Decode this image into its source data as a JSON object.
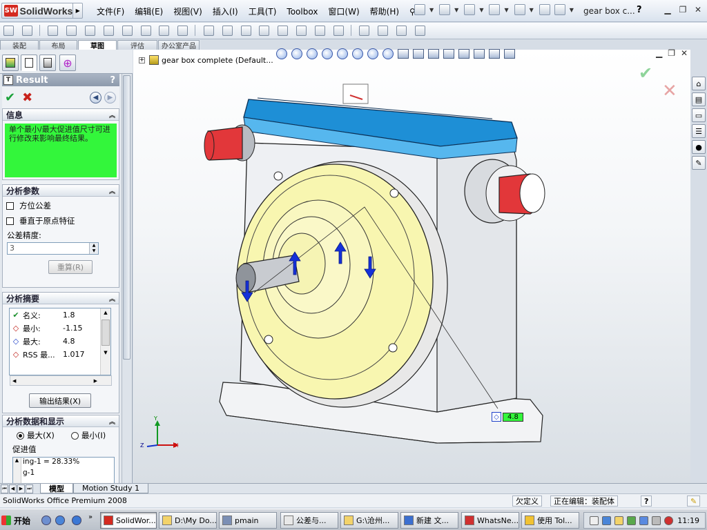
{
  "app": {
    "logo_text": "SolidWorks",
    "doc_title": "gear box c...",
    "help": "?"
  },
  "menu": {
    "items": [
      "文件(F)",
      "编辑(E)",
      "视图(V)",
      "插入(I)",
      "工具(T)",
      "Toolbox",
      "窗口(W)",
      "帮助(H)"
    ]
  },
  "command_tabs": [
    "装配",
    "布局",
    "草图",
    "评估",
    "办公室产品"
  ],
  "property_manager": {
    "title": "Result",
    "help": "?",
    "info": {
      "header": "信息",
      "message": "单个最小/最大促进值尺寸可进行修改来影响最终结果。"
    },
    "params": {
      "header": "分析参数",
      "checkbox_1": "方位公差",
      "checkbox_2": "垂直于原点特征",
      "precision_label": "公差精度:",
      "precision_value": "3",
      "recalc_button": "重算(R)"
    },
    "summary": {
      "header": "分析摘要",
      "rows": [
        {
          "label": "名义:",
          "value": "1.8"
        },
        {
          "label": "最小:",
          "value": "-1.15"
        },
        {
          "label": "最大:",
          "value": "4.8"
        },
        {
          "label": "RSS 最...",
          "value": "1.017"
        }
      ],
      "export_button": "输出结果(X)"
    },
    "display": {
      "header": "分析数据和显示",
      "radio_max": "最大(X)",
      "radio_min": "最小(I)",
      "contrib_label": "促进值",
      "contrib_items": [
        "ing-1 = 28.33%",
        "g-1"
      ]
    }
  },
  "graphics": {
    "tree_node": "gear box complete  (Default...",
    "dimension_tag": "4.8",
    "triad": {
      "x": "X",
      "y": "Y",
      "z": "Z"
    }
  },
  "bottom_tabs": [
    "模型",
    "Motion Study 1"
  ],
  "status": {
    "app_name": "SolidWorks Office Premium 2008",
    "under_defined": "欠定义",
    "editing": "正在编辑：装配体",
    "help": "?"
  },
  "taskbar": {
    "start": "开始",
    "tasks": [
      "SolidWor...",
      "D:\\My Do...",
      "pmain",
      "公差与...",
      "G:\\沧州...",
      "新建 文...",
      "WhatsNe...",
      "使用 Tol..."
    ],
    "clock": "11:19"
  },
  "colors": {
    "model_yellow": "#f8f6b0",
    "model_blue": "#1e8fd6",
    "model_red": "#e2373a",
    "info_green": "#33f63b",
    "arrow_blue": "#1530d8"
  }
}
